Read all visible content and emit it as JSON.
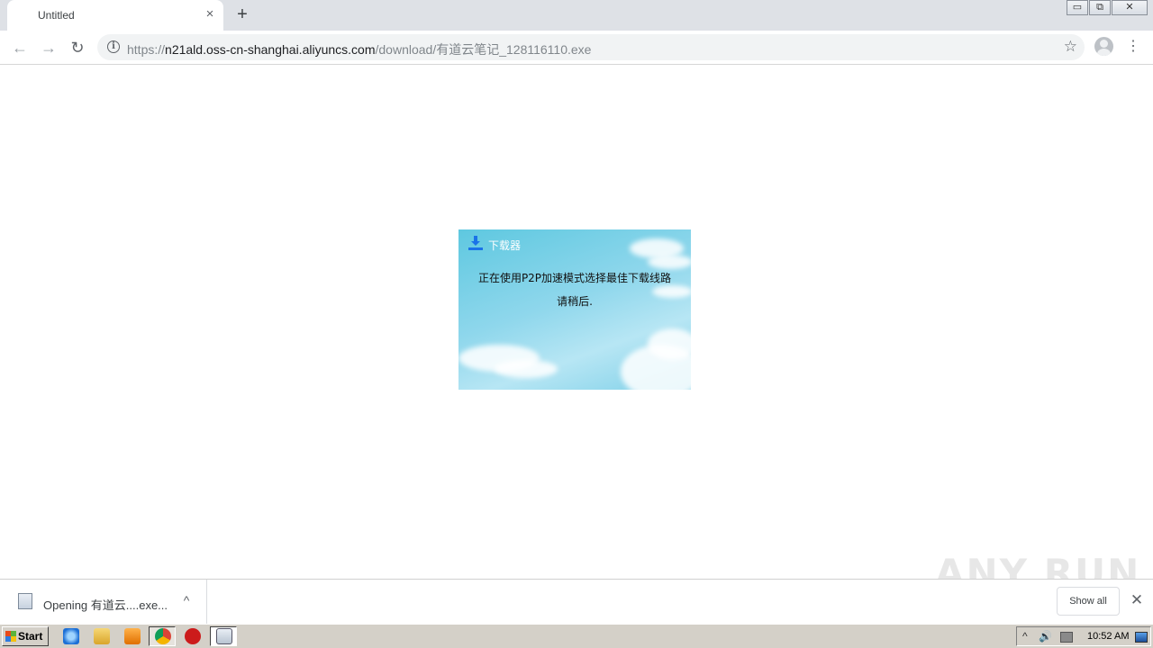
{
  "browser": {
    "tab": {
      "title": "Untitled",
      "close": "×"
    },
    "new_tab": "+",
    "window_controls": {
      "minimize": "▭",
      "restore": "⧉",
      "close": "✕"
    },
    "toolbar": {
      "back": "←",
      "forward": "→",
      "reload": "↻",
      "info": "i",
      "url_scheme": "https://",
      "url_host": "n21ald.oss-cn-shanghai.aliyuncs.com",
      "url_path": "/download/有道云笔记_128116110.exe",
      "bookmark": "☆",
      "menu": "⋮"
    }
  },
  "dialog": {
    "title": "下载器",
    "message_line1": "正在使用P2P加速模式选择最佳下载线路",
    "message_line2": "请稍后."
  },
  "download_shelf": {
    "item_label": "Opening 有道云....exe...",
    "caret": "^",
    "show_all": "Show all",
    "close": "✕"
  },
  "watermark": "ANY  RUN",
  "taskbar": {
    "start_label": "Start",
    "clock": "10:52 AM",
    "tray_up": "^",
    "tray_volume": "🔊"
  },
  "colors": {
    "tab_strip": "#dee1e6",
    "omnibox": "#f1f3f4",
    "dialog_sky": "#8fd7ec",
    "taskbar": "#d4d0c8"
  }
}
